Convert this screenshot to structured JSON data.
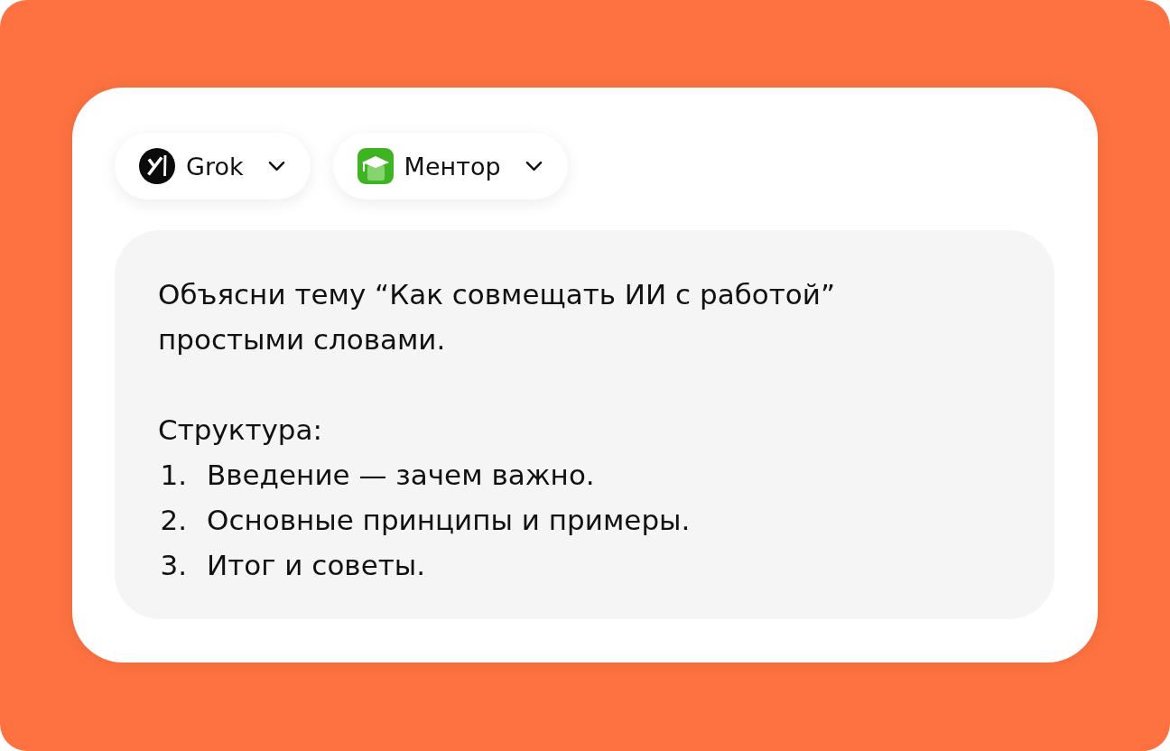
{
  "selectors": [
    {
      "kind": "grok",
      "label": "Grok"
    },
    {
      "kind": "mentor",
      "label": "Ментор"
    }
  ],
  "prompt": {
    "text": "Объясни тему “Как совмещать ИИ с работой” простыми словами.",
    "heading": "Структура:",
    "steps": [
      {
        "number": "1.",
        "text": "Введение — зачем важно."
      },
      {
        "number": "2.",
        "text": "Основные принципы и примеры."
      },
      {
        "number": "3.",
        "text": "Итог и советы."
      }
    ]
  }
}
